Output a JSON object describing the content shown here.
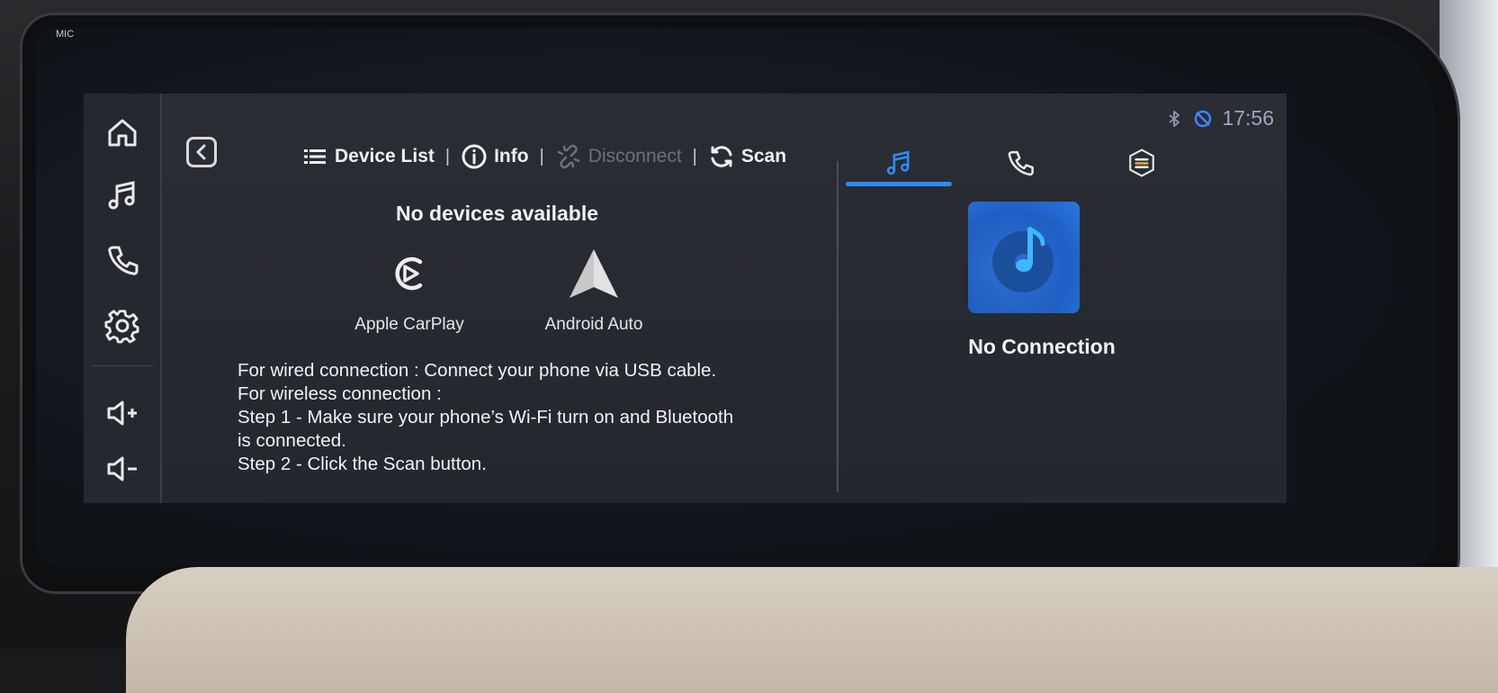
{
  "bezel": {
    "mic_label": "MIC"
  },
  "status": {
    "time": "17:56",
    "bluetooth_icon": "bluetooth-icon",
    "connection_icon": "carplay-status-icon"
  },
  "left_rail": {
    "items": [
      {
        "name": "home",
        "icon": "home-icon"
      },
      {
        "name": "music",
        "icon": "music-note-icon"
      },
      {
        "name": "phone",
        "icon": "phone-icon"
      },
      {
        "name": "settings",
        "icon": "gear-icon"
      },
      {
        "name": "volume-up",
        "icon": "volume-up-icon"
      },
      {
        "name": "volume-down",
        "icon": "volume-down-icon"
      }
    ]
  },
  "toolbar": {
    "device_list": "Device List",
    "info": "Info",
    "disconnect": "Disconnect",
    "scan": "Scan",
    "separator": "|"
  },
  "main": {
    "no_devices": "No devices available",
    "options": [
      {
        "label": "Apple CarPlay",
        "icon": "carplay-icon"
      },
      {
        "label": "Android Auto",
        "icon": "android-auto-icon"
      }
    ],
    "instructions": [
      "For wired connection : Connect your phone via USB cable.",
      "For wireless connection :",
      "Step 1 - Make sure your phone’s Wi-Fi turn on and Bluetooth",
      "is connected.",
      "Step 2 - Click the Scan button."
    ]
  },
  "media": {
    "tabs": [
      {
        "name": "music",
        "icon": "music-note-icon",
        "active": true
      },
      {
        "name": "phone",
        "icon": "phone-icon",
        "active": false
      },
      {
        "name": "app",
        "icon": "layers-icon",
        "active": false
      }
    ],
    "status_text": "No Connection"
  },
  "colors": {
    "accent": "#2d8cff",
    "background": "#24272d",
    "text": "#f2f2f2",
    "disabled": "#6d7178"
  }
}
